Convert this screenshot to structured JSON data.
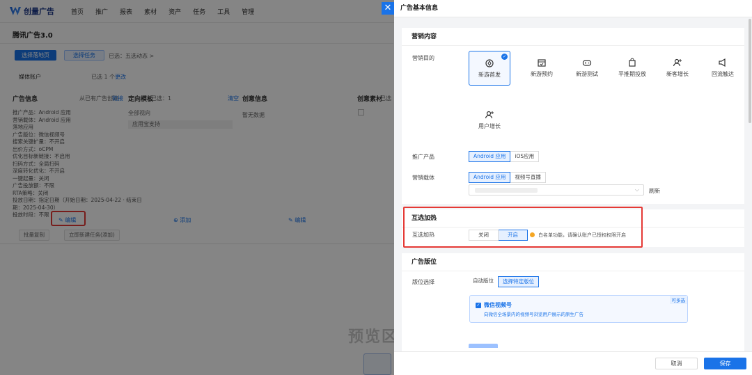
{
  "topnav": {
    "logo_text": "创量广告",
    "items": [
      "首页",
      "推广",
      "报表",
      "素材",
      "资产",
      "任务",
      "工具",
      "管理"
    ]
  },
  "page": {
    "title": "腾讯广告3.0",
    "btn_primary": "选择落地页",
    "btn_secondary": "选择任务",
    "selected": "已选：五选动态 >",
    "account_label": "媒体账户",
    "account_count": "已选 1 个",
    "account_link": "更改",
    "col_ad_info": "广告信息",
    "col_ad_info_hint": "从已有广告创建",
    "col_ad_info_link": "链接",
    "col_targeting": "定向模板",
    "col_targeting_count": "已选：1",
    "col_targeting_link": "清空",
    "col_creative": "创意信息",
    "col_material": "创意素材",
    "col_material_hint": "已选",
    "targeting_sub": "全部视向",
    "targeting_chip": "应用宝支持",
    "creative_value": "暂无数据",
    "info_lines": [
      "推广产品：Android 应用",
      "营销载体：Android 应用",
      "落地应用",
      "广告版位：微信视频号",
      "搜索关键扩量：不开启",
      "出价方式：oCPM",
      "优化目标新链接：不启用",
      "扫码方式：全局扫码",
      "深度转化优化：不开启",
      "一键起量：关闭",
      "广告投放额：不限",
      "RTA策略：关闭",
      "投放日期：指定日期（开始日期：2025-04-22 · 结束日",
      "期：2025-04-30）",
      "投放时段：不限"
    ],
    "edit_label": "编辑",
    "add_label": "添加",
    "edit_label_2": "编辑",
    "bottom_btn_1": "批量复制",
    "bottom_btn_2": "立即新建任务(添加)",
    "preview_label": "预览区"
  },
  "drawer": {
    "title": "广告基本信息",
    "marketing": {
      "title": "营销内容",
      "goal_label": "营销目的",
      "goals": [
        "新游首发",
        "新游预约",
        "新游测试",
        "平推期投放",
        "新客增长",
        "回流触达",
        "用户增长"
      ],
      "product_label": "推广产品",
      "product_options": [
        "Android 应用",
        "iOS应用"
      ],
      "carrier_label": "营销载体",
      "carrier_options": [
        "Android 应用",
        "视频号直播"
      ],
      "refresh_link": "刷新"
    },
    "mutual": {
      "title": "互选加热",
      "row_label": "互选加热",
      "options": [
        "关闭",
        "开启"
      ],
      "warning": "白名单功能，请确认账户已授权权限开启"
    },
    "placement": {
      "title": "广告版位",
      "row_label": "版位选择",
      "options": [
        "自动版位",
        "选择特定版位"
      ],
      "wechat_title": "微信视频号",
      "wechat_desc": "向微信全场景内的视频号浏览用户展示的原生广告",
      "multi_tag": "可多选"
    },
    "footer": {
      "cancel": "取消",
      "save": "保存"
    }
  }
}
